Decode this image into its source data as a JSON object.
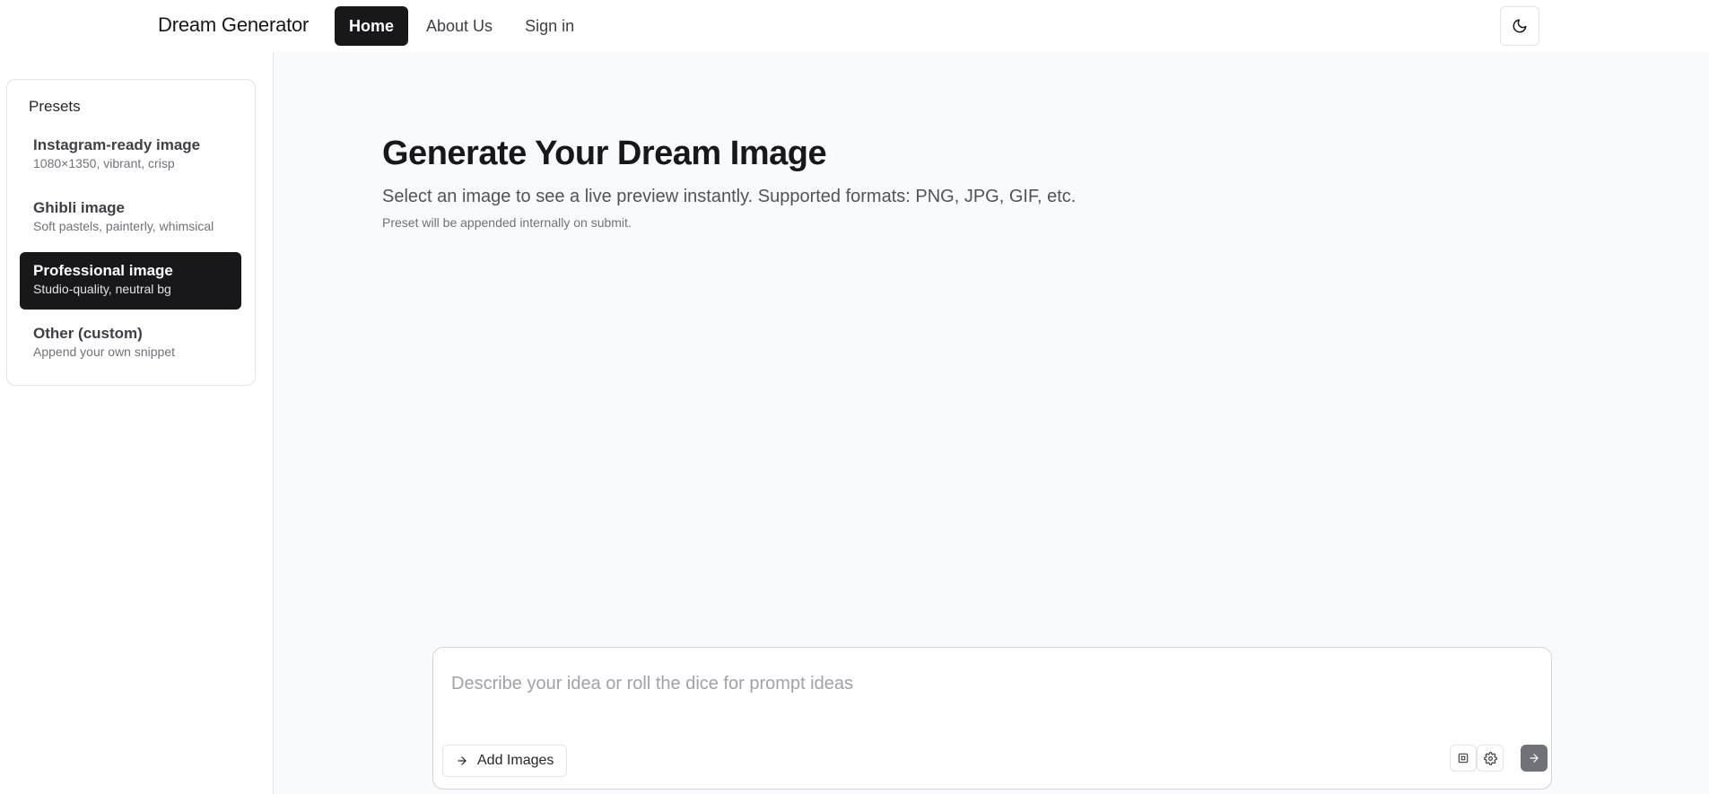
{
  "header": {
    "brand": "Dream Generator",
    "nav": [
      {
        "label": "Home",
        "active": true
      },
      {
        "label": "About Us",
        "active": false
      },
      {
        "label": "Sign in",
        "active": false
      }
    ],
    "theme_toggle_icon": "moon-icon"
  },
  "sidebar": {
    "title": "Presets",
    "presets": [
      {
        "label": "Instagram-ready image",
        "description": "1080×1350, vibrant, crisp",
        "selected": false
      },
      {
        "label": "Ghibli image",
        "description": "Soft pastels, painterly, whimsical",
        "selected": false
      },
      {
        "label": "Professional image",
        "description": "Studio-quality, neutral bg",
        "selected": true
      },
      {
        "label": "Other (custom)",
        "description": "Append your own snippet",
        "selected": false
      }
    ]
  },
  "main": {
    "title": "Generate Your Dream Image",
    "subtitle": "Select an image to see a live preview instantly. Supported formats: PNG, JPG, GIF, etc.",
    "note": "Preset will be appended internally on submit."
  },
  "composer": {
    "value": "",
    "placeholder": "Describe your idea or roll the dice for prompt ideas",
    "add_images_label": "Add Images",
    "icons": [
      "square-icon",
      "gear-icon",
      "arrow-right-icon"
    ]
  },
  "colors": {
    "primary": "#18181b",
    "background": "#f9fafb",
    "border": "#e4e4e7",
    "submit": "#71717a"
  }
}
